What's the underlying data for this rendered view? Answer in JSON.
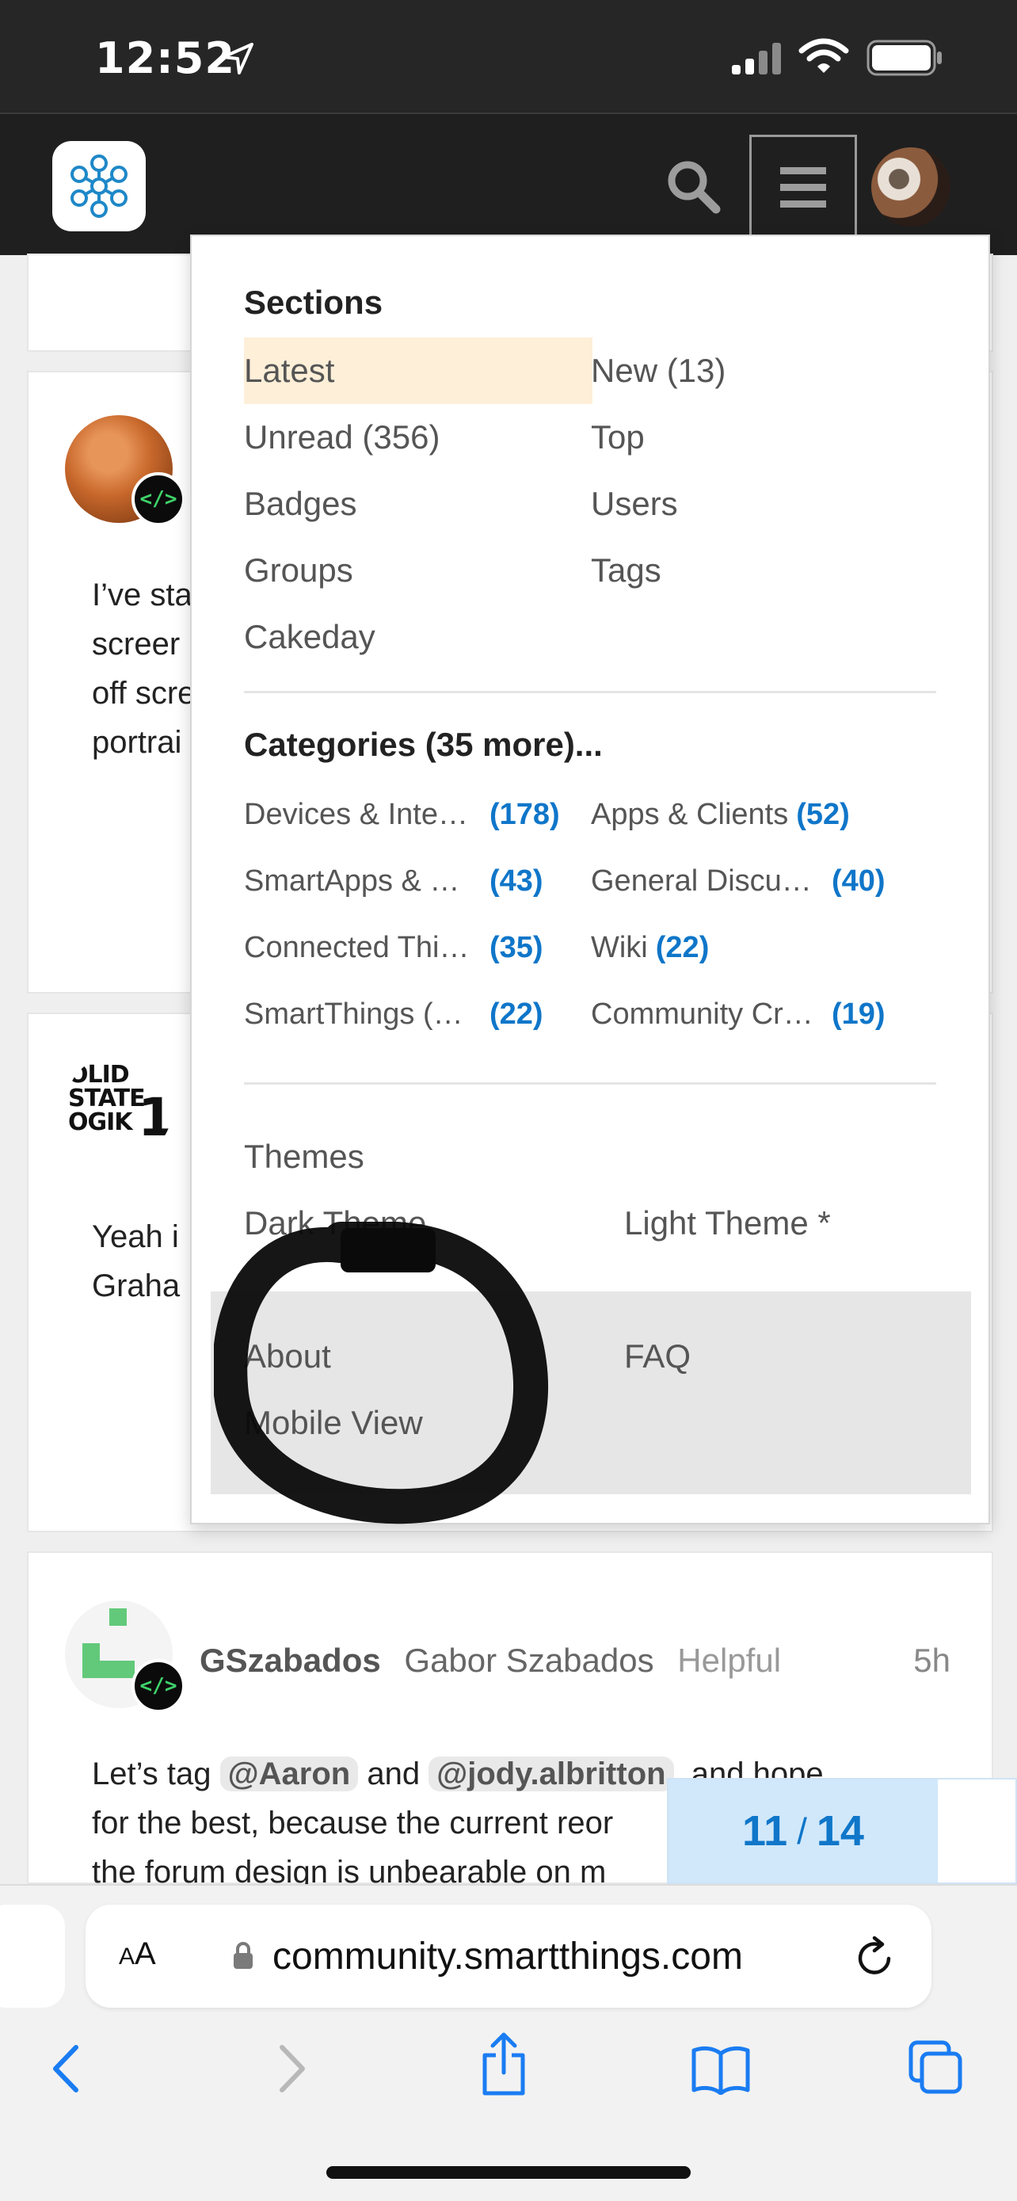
{
  "status_bar": {
    "time": "12:52",
    "icons": [
      "location-arrow-icon",
      "signal-icon",
      "wifi-icon",
      "battery-icon"
    ]
  },
  "header": {
    "icons": [
      "smartthings-logo",
      "search-icon",
      "hamburger-menu-icon",
      "user-avatar"
    ]
  },
  "posts": [
    {
      "text_lines": [
        "I’ve sta",
        "screer",
        "off scre",
        "portrai"
      ]
    },
    {
      "avatar_lines": [
        "OLID",
        "STATE",
        "OGIK",
        "1"
      ],
      "text_lines": [
        "Yeah i",
        "Graha"
      ]
    },
    {
      "username": "GSzabados",
      "full_name": "Gabor Szabados",
      "user_title": "Helpful",
      "time": "5h",
      "line1_start": "Let’s tag",
      "mention1": "@Aaron",
      "line1_and": "and",
      "mention2": "@jody.albritton",
      "line1_end": ", and hope",
      "line2": "for the best, because the current reor",
      "line3": "the forum design is unbearable on m"
    }
  ],
  "menu": {
    "sections_heading": "Sections",
    "sections": [
      {
        "label": "Latest",
        "active": true
      },
      {
        "label": "New (13)"
      },
      {
        "label": "Unread (356)"
      },
      {
        "label": "Top"
      },
      {
        "label": "Badges"
      },
      {
        "label": "Users"
      },
      {
        "label": "Groups"
      },
      {
        "label": "Tags"
      },
      {
        "label": "Cakeday"
      }
    ],
    "categories_heading": "Categories (35 more)...",
    "categories": [
      {
        "name": "Devices & Inte…",
        "count": "(178)"
      },
      {
        "name": "Apps & Clients",
        "count": "(52)"
      },
      {
        "name": "SmartApps & …",
        "count": "(43)"
      },
      {
        "name": "General Discu…",
        "count": "(40)"
      },
      {
        "name": "Connected Thi…",
        "count": "(35)"
      },
      {
        "name": "Wiki",
        "count": "(22)"
      },
      {
        "name": "SmartThings (…",
        "count": "(22)"
      },
      {
        "name": "Community Cr…",
        "count": "(19)"
      }
    ],
    "themes_heading": "Themes",
    "themes": [
      "Dark Theme",
      "Light Theme *"
    ],
    "footer_links": [
      "About",
      "FAQ",
      "Mobile View"
    ]
  },
  "timeline": {
    "current": "11",
    "separator": "/",
    "total": "14",
    "progress_fraction": 0.786
  },
  "browser": {
    "aa_label_small": "A",
    "aa_label_large": "A",
    "url": "community.smartthings.com",
    "toolbar_icons": [
      "back-icon",
      "forward-icon",
      "share-icon",
      "bookmarks-icon",
      "tabs-icon"
    ]
  }
}
